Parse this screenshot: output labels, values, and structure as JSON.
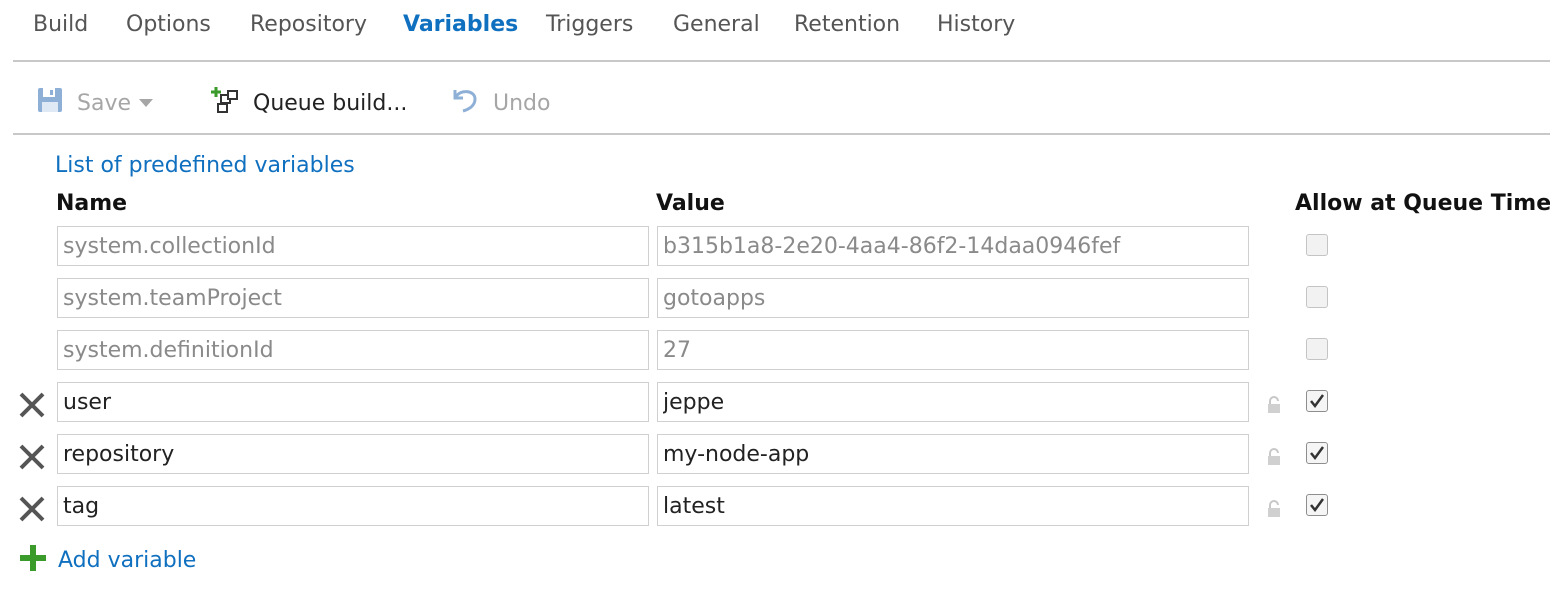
{
  "tabs": [
    {
      "label": "Build",
      "active": false
    },
    {
      "label": "Options",
      "active": false
    },
    {
      "label": "Repository",
      "active": false
    },
    {
      "label": "Variables",
      "active": true
    },
    {
      "label": "Triggers",
      "active": false
    },
    {
      "label": "General",
      "active": false
    },
    {
      "label": "Retention",
      "active": false
    },
    {
      "label": "History",
      "active": false
    }
  ],
  "toolbar": {
    "save_label": "Save",
    "queue_label": "Queue build...",
    "undo_label": "Undo"
  },
  "predefined_link": "List of predefined variables",
  "columns": {
    "name": "Name",
    "value": "Value",
    "allow": "Allow at Queue Time"
  },
  "variables": [
    {
      "name": "system.collectionId",
      "value": "b315b1a8-2e20-4aa4-86f2-14daa0946fef",
      "allow_at_queue_time": false,
      "readonly": true
    },
    {
      "name": "system.teamProject",
      "value": "gotoapps",
      "allow_at_queue_time": false,
      "readonly": true
    },
    {
      "name": "system.definitionId",
      "value": "27",
      "allow_at_queue_time": false,
      "readonly": true
    },
    {
      "name": "user",
      "value": "jeppe",
      "allow_at_queue_time": true,
      "readonly": false
    },
    {
      "name": "repository",
      "value": "my-node-app",
      "allow_at_queue_time": true,
      "readonly": false
    },
    {
      "name": "tag",
      "value": "latest",
      "allow_at_queue_time": true,
      "readonly": false
    }
  ],
  "add_variable_label": "Add variable",
  "colors": {
    "accent": "#1070c0",
    "disabled_text": "#a6a6a6",
    "add_icon": "#3a9a2a"
  },
  "icons": {
    "save": "save-icon",
    "queue": "queue-build-icon",
    "undo": "undo-icon",
    "delete": "delete-x-icon",
    "lock": "lock-icon",
    "add": "plus-icon"
  }
}
